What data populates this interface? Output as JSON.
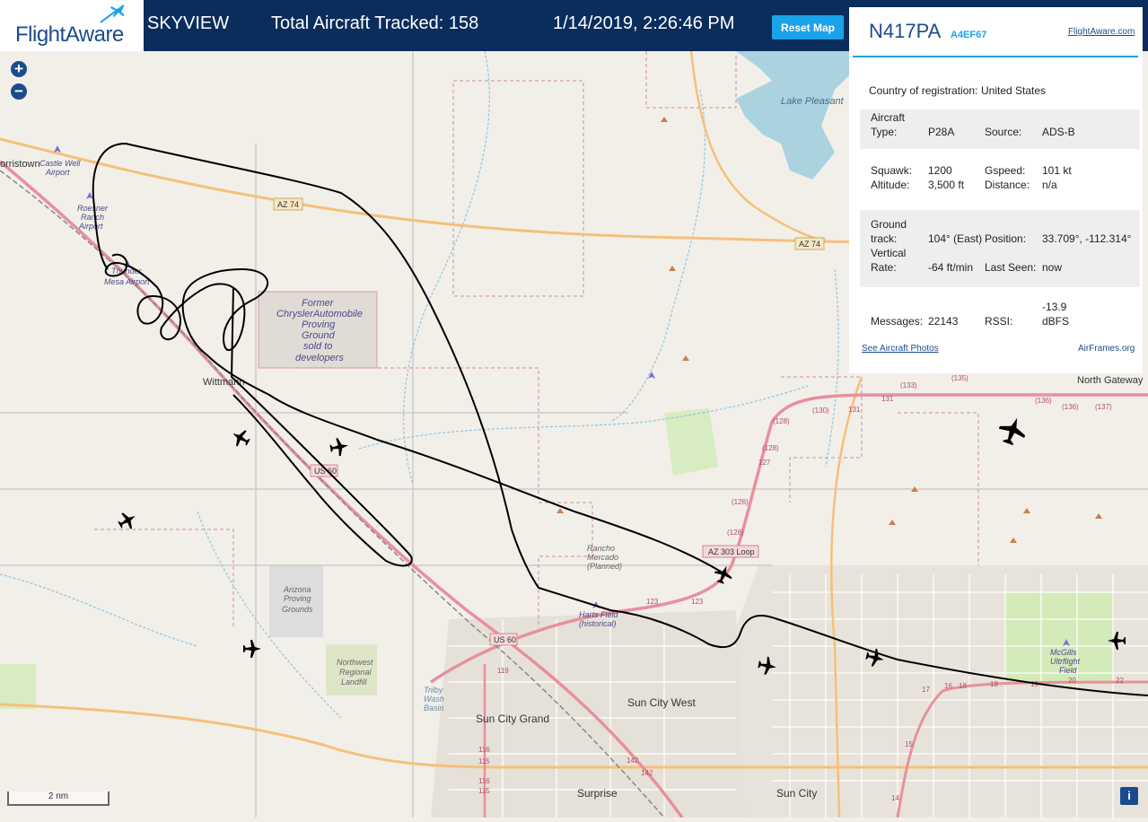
{
  "header": {
    "brand": "FlightAware",
    "app_name": "SKYVIEW",
    "total_tracked": "Total Aircraft Tracked: 158",
    "datetime": "1/14/2019, 2:26:46 PM",
    "reset_label": "Reset Map"
  },
  "map_controls": {
    "zoom_in": "+",
    "zoom_out": "−",
    "scale": "2 nm",
    "info": "i"
  },
  "map_labels": {
    "lake_pleasant": "Lake Pleasant",
    "norristown": "orristown",
    "castle_well_1": "Castle Well",
    "castle_well_2": "Airport",
    "roesner_1": "Roesner",
    "roesner_2": "Ranch",
    "roesner_3": "Airport",
    "pleasant_1": "Thunder",
    "pleasant_2": "Mesa Airport",
    "chrysler_1": "Former",
    "chrysler_2": "ChryslerAutomobile",
    "chrysler_3": "Proving",
    "chrysler_4": "Ground",
    "chrysler_5": "sold to",
    "chrysler_6": "developers",
    "wittmann": "Wittmann",
    "us60_a": "US 60",
    "us60_b": "US 60",
    "az74_a": "AZ 74",
    "az74_b": "AZ 74",
    "az303": "AZ 303 Loop",
    "rancho_1": "Rancho",
    "rancho_2": "Mercado",
    "rancho_3": "(Planned)",
    "harts_1": "Harts Field",
    "harts_2": "(historical)",
    "arizona_1": "Arizona",
    "arizona_2": "Proving",
    "arizona_3": "Grounds",
    "nw_1": "Northwest",
    "nw_2": "Regional",
    "nw_3": "Landfill",
    "trilby_1": "Trilby",
    "trilby_2": "Wash",
    "trilby_3": "Basin",
    "sun_city_grand": "Sun City Grand",
    "sun_city_west": "Sun City West",
    "sun_city": "Sun City",
    "surprise": "Surprise",
    "north_gateway": "North Gateway",
    "mcgills_1": "McGills",
    "mcgills_2": "Ultrflight",
    "mcgills_3": "Field",
    "r128a": "(128)",
    "r128b": "(128)",
    "r127": "127",
    "r126": "(126)",
    "r126b": "(126)",
    "r130": "(130)",
    "r131a": "131",
    "r131b": "131",
    "r133": "(133)",
    "r135": "(135)",
    "r136a": "(136)",
    "r136b": "(136)",
    "r137": "(137)",
    "r123a": "123",
    "r123b": "123",
    "r119": "119",
    "r116a": "116",
    "r116b": "116",
    "r115a": "115",
    "r115b": "115",
    "r142a": "142",
    "r142b": "142",
    "r17": "17",
    "r16": "16",
    "r18a": "18",
    "r18b": "18",
    "r19": "19",
    "r20": "20",
    "r22": "22",
    "r15": "15",
    "r14": "14"
  },
  "panel": {
    "registration": "N417PA",
    "hex": "A4EF67",
    "fa_link": "FlightAware.com",
    "country_label": "Country of registration:",
    "country_value": "United States",
    "type_label_1": "Aircraft",
    "type_label_2": "Type:",
    "type_value": "P28A",
    "source_label": "Source:",
    "source_value": "ADS-B",
    "squawk_label": "Squawk:",
    "squawk_value": "1200",
    "gspeed_label": "Gspeed:",
    "gspeed_value": "101 kt",
    "altitude_label": "Altitude:",
    "altitude_value": "3,500 ft",
    "distance_label": "Distance:",
    "distance_value": "n/a",
    "gt_label_1": "Ground",
    "gt_label_2": "track:",
    "gt_value": "104° (East)",
    "position_label": "Position:",
    "position_value": "33.709°, -112.314°",
    "vr_label_1": "Vertical",
    "vr_label_2": "Rate:",
    "vr_value": "-64 ft/min",
    "lastseen_label": "Last Seen:",
    "lastseen_value": "now",
    "messages_label": "Messages:",
    "messages_value": "22143",
    "rssi_label": "RSSI:",
    "rssi_value_1": "-13.9",
    "rssi_value_2": "dBFS",
    "photos_link": "See Aircraft Photos",
    "airframes_link": "AirFrames.org"
  },
  "colors": {
    "header_bg": "#0a2d5c",
    "accent": "#1aa3e8",
    "map_bg": "#f2efe9",
    "track": "#000000"
  }
}
